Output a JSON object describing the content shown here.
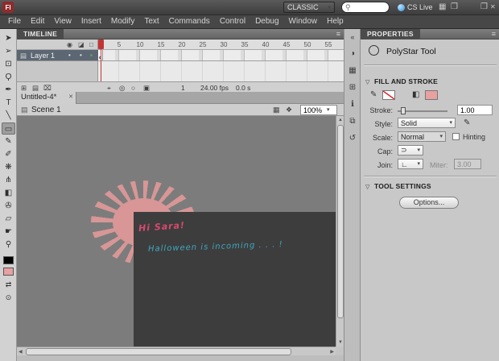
{
  "app_bar": {
    "workspace_label": "CLASSIC",
    "search_value": "",
    "cs_live_label": "CS Live"
  },
  "menu_bar": {
    "items": [
      "File",
      "Edit",
      "View",
      "Insert",
      "Modify",
      "Text",
      "Commands",
      "Control",
      "Debug",
      "Window",
      "Help"
    ]
  },
  "toolbar": {
    "tools": [
      {
        "name": "selection",
        "glyph": "➤"
      },
      {
        "name": "subselection",
        "glyph": "➢"
      },
      {
        "name": "free-transform",
        "glyph": "⊡"
      },
      {
        "name": "lasso",
        "glyph": "Ϙ"
      },
      {
        "name": "pen",
        "glyph": "✒"
      },
      {
        "name": "text",
        "glyph": "T"
      },
      {
        "name": "line",
        "glyph": "╲"
      },
      {
        "name": "rectangle",
        "glyph": "▭"
      },
      {
        "name": "pencil",
        "glyph": "✎"
      },
      {
        "name": "brush",
        "glyph": "✐"
      },
      {
        "name": "deco",
        "glyph": "❋"
      },
      {
        "name": "bone",
        "glyph": "⋔"
      },
      {
        "name": "paint-bucket",
        "glyph": "◧"
      },
      {
        "name": "eyedropper",
        "glyph": "✇"
      },
      {
        "name": "eraser",
        "glyph": "▱"
      },
      {
        "name": "hand",
        "glyph": "☛"
      },
      {
        "name": "zoom",
        "glyph": "⚲"
      }
    ]
  },
  "timeline": {
    "tab_label": "TIMELINE",
    "frame_labels": [
      "5",
      "10",
      "15",
      "20",
      "25",
      "30",
      "35",
      "40",
      "45",
      "50",
      "55"
    ],
    "layers": [
      {
        "name": "Layer 1"
      }
    ],
    "status": {
      "current_frame": "1",
      "frame_rate": "24.00 fps",
      "elapsed_time": "0.0 s"
    }
  },
  "document_bar": {
    "tab_label": "Untitled-4*"
  },
  "edit_bar": {
    "scene_label": "Scene 1",
    "zoom_value": "100%"
  },
  "stage": {
    "greeting_text": "Hi Sara!",
    "message_text": "Halloween is incoming . . . !"
  },
  "properties": {
    "tab_label": "PROPERTIES",
    "tool_name": "PolyStar Tool",
    "sections": {
      "fill_and_stroke": "FILL AND STROKE",
      "tool_settings": "TOOL SETTINGS"
    },
    "fields": {
      "stroke_label": "Stroke:",
      "stroke_value": "1.00",
      "style_label": "Style:",
      "style_value": "Solid",
      "scale_label": "Scale:",
      "scale_value": "Normal",
      "hinting_label": "Hinting",
      "cap_label": "Cap:",
      "join_label": "Join:",
      "miter_label": "Miter:",
      "miter_value": "3.00"
    },
    "options_button_label": "Options..."
  },
  "icons": {
    "app_logo": "Fl",
    "caret": "▾",
    "magnifier": "⚲",
    "arrange_documents": "▦",
    "screen_mode": "❐",
    "panel_menu": "≡",
    "eye": "◉",
    "lock": "◪",
    "outline_square": "□",
    "layer_page": "▤",
    "layer_dot": "•",
    "layer_outline_swatch": "▪",
    "new_layer": "⊞",
    "new_folder": "▤",
    "delete_layer": "⌧",
    "center_frame": "⌖",
    "onion_skin": "◎",
    "onion_outline": "○",
    "edit_multiple_frames": "▣",
    "tab_close": "✕",
    "scene_clapper": "▤",
    "edit_scene": "▦",
    "edit_symbol": "❖",
    "scroll_up": "▲",
    "scroll_down": "▼",
    "scroll_left": "◀",
    "scroll_right": "▶",
    "expand_dock": "«",
    "color_panel": "◑",
    "swatches_panel": "▦",
    "align_panel": "⊞",
    "info_panel": "ℹ",
    "transform_panel": "⧉",
    "history_panel": "↺",
    "pencil_small": "✎",
    "bucket_small": "◧",
    "cap_glyph": "⊃",
    "join_glyph": "∟",
    "section_triangle": "▽",
    "snap_magnet": "⊙",
    "swap_colors": "⇄"
  },
  "colors": {
    "starburst": "#d89696",
    "greeting_text": "#d84a6e",
    "message_text": "#3fa8c0",
    "playhead": "#c23434",
    "fill_swatch": "#e8a0a0",
    "stage_rect": "#3d3d3d"
  }
}
